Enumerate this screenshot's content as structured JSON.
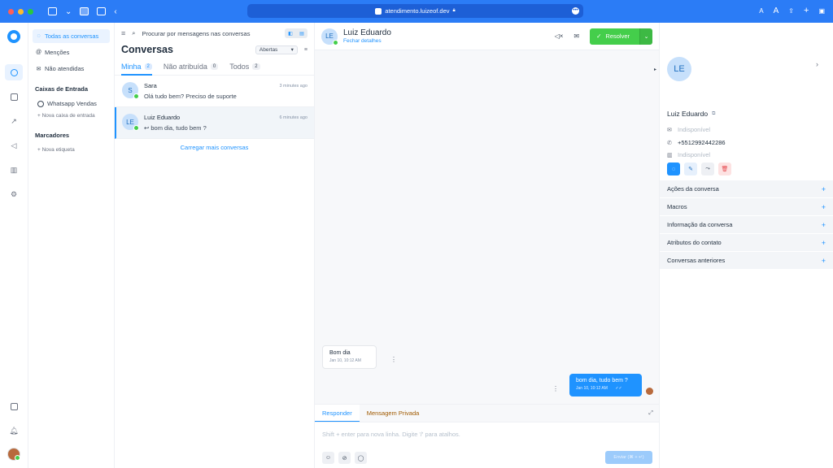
{
  "browser": {
    "url": "atendimento.luizeof.dev"
  },
  "sidebar": {
    "items": [
      {
        "icon": "chat-icon",
        "label": "Todas as conversas"
      },
      {
        "icon": "mention-icon",
        "label": "Menções"
      },
      {
        "icon": "inbox-icon",
        "label": "Não atendidas"
      }
    ],
    "inboxes_heading": "Caixas de Entrada",
    "inbox": "Whatsapp Vendas",
    "add_inbox": "+ Nova caixa de entrada",
    "labels_heading": "Marcadores",
    "add_label": "+ Nova etiqueta"
  },
  "conversations": {
    "search_placeholder": "Procurar por mensagens nas conversas",
    "title": "Conversas",
    "status_filter": "Abertas",
    "tabs": [
      {
        "label": "Minha",
        "count": "2"
      },
      {
        "label": "Não atribuída",
        "count": "0"
      },
      {
        "label": "Todos",
        "count": "2"
      }
    ],
    "items": [
      {
        "initials": "S",
        "name": "Sara",
        "time": "3 minutes ago",
        "message": "Olá tudo bem? Preciso de suporte"
      },
      {
        "initials": "LE",
        "name": "Luiz Eduardo",
        "time": "6 minutes ago",
        "message": "bom dia, tudo bem ?"
      }
    ],
    "load_more": "Carregar mais conversas"
  },
  "chat": {
    "initials": "LE",
    "name": "Luiz Eduardo",
    "close_details": "Fechar detalhes",
    "resolve_label": "Resolver",
    "messages": [
      {
        "text": "Bom dia",
        "time": "Jan 10, 10:12 AM"
      },
      {
        "text": "bom dia, tudo bem ?",
        "time": "Jan 10, 10:12 AM"
      }
    ],
    "reply_tab": "Responder",
    "private_tab": "Mensagem Privada",
    "composer_placeholder": "Shift + enter para nova linha. Digite '/' para atalhos.",
    "send_label": "Enviar (⌘ + ↵)"
  },
  "contact": {
    "initials": "LE",
    "name": "Luiz Eduardo",
    "email": "Indisponível",
    "phone": "+5512992442286",
    "company": "Indisponível",
    "sections": [
      "Ações da conversa",
      "Macros",
      "Informação da conversa",
      "Atributos do contato",
      "Conversas anteriores"
    ]
  },
  "colors": {
    "accent": "#1f93ff",
    "resolve": "#44ce4b",
    "browser_bar": "#2b7cf6"
  }
}
